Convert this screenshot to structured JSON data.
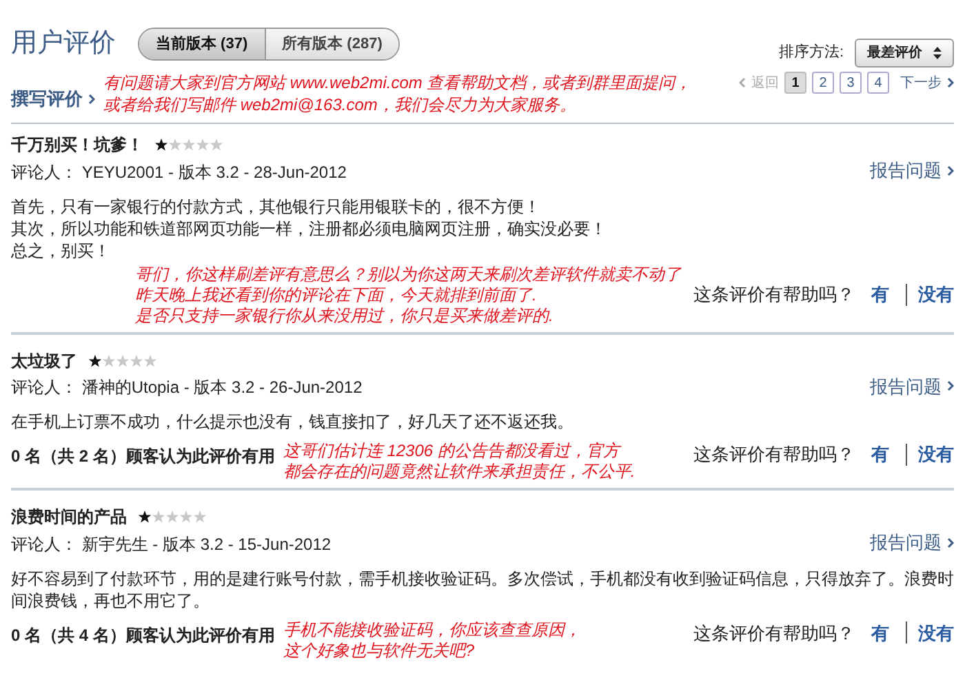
{
  "header": {
    "title": "用户评价",
    "tabs": [
      {
        "label": "当前版本 (37)",
        "selected": true
      },
      {
        "label": "所有版本 (287)",
        "selected": false
      }
    ],
    "sort": {
      "label": "排序方法:",
      "value": "最差评价"
    }
  },
  "toolbar": {
    "write_review": "撰写评价",
    "annotation": "有问题请大家到官方网站 www.web2mi.com 查看帮助文档，或者到群里面提问，或者给我们写邮件 web2mi@163.com，我们会尽力为大家服务。",
    "previous": "返回",
    "pages": [
      {
        "label": "1",
        "selected": true
      },
      {
        "label": "2",
        "selected": false
      },
      {
        "label": "3",
        "selected": false
      },
      {
        "label": "4",
        "selected": false
      }
    ],
    "next": "下一步"
  },
  "reviews": [
    {
      "title": "千万别买！坑爹！",
      "stars": 1,
      "reviewer": "评论人：  YEYU2001 - 版本 3.2 - 28-Jun-2012",
      "report": "报告问题",
      "body": [
        "首先，只有一家银行的付款方式，其他银行只能用银联卡的，很不方便！",
        "其次，所以功能和铁道部网页功能一样，注册都必须电脑网页注册，确实没必要！",
        "总之，别买！"
      ],
      "annotation": [
        "哥们，你这样刷差评有意思么？别以为你这两天来刷次差评软件就卖不动了",
        "昨天晚上我还看到你的评论在下面，今天就排到前面了.",
        "是否只支持一家银行你从来没用过，你只是买来做差评的."
      ],
      "question": "这条评价有帮助吗？",
      "yes": "有",
      "no": "没有"
    },
    {
      "title": "太垃圾了",
      "stars": 1,
      "reviewer": "评论人：  潘神的Utopia - 版本 3.2 - 26-Jun-2012",
      "report": "报告问题",
      "body": [
        "在手机上订票不成功，什么提示也没有，钱直接扣了，好几天了还不返还我。"
      ],
      "helpful": "0 名（共 2 名）顾客认为此评价有用",
      "annotation": [
        "这哥们估计连 12306 的公告告都没看过，官方",
        "都会存在的问题竟然让软件来承担责任，不公平."
      ],
      "question": "这条评价有帮助吗？",
      "yes": "有",
      "no": "没有"
    },
    {
      "title": "浪费时间的产品",
      "stars": 1,
      "reviewer": "评论人：  新宇先生 - 版本 3.2 - 15-Jun-2012",
      "report": "报告问题",
      "body": [
        "好不容易到了付款环节，用的是建行账号付款，需手机接收验证码。多次偿试，手机都没有收到验证码信息，只得放弃了。浪费时间浪费钱，再也不用它了。"
      ],
      "helpful": "0 名（共 4 名）顾客认为此评价有用",
      "annotation": [
        "手机不能接收验证码，你应该查查原因，",
        "这个好象也与软件无关吧?"
      ],
      "question": "这条评价有帮助吗？",
      "yes": "有",
      "no": "没有"
    }
  ]
}
